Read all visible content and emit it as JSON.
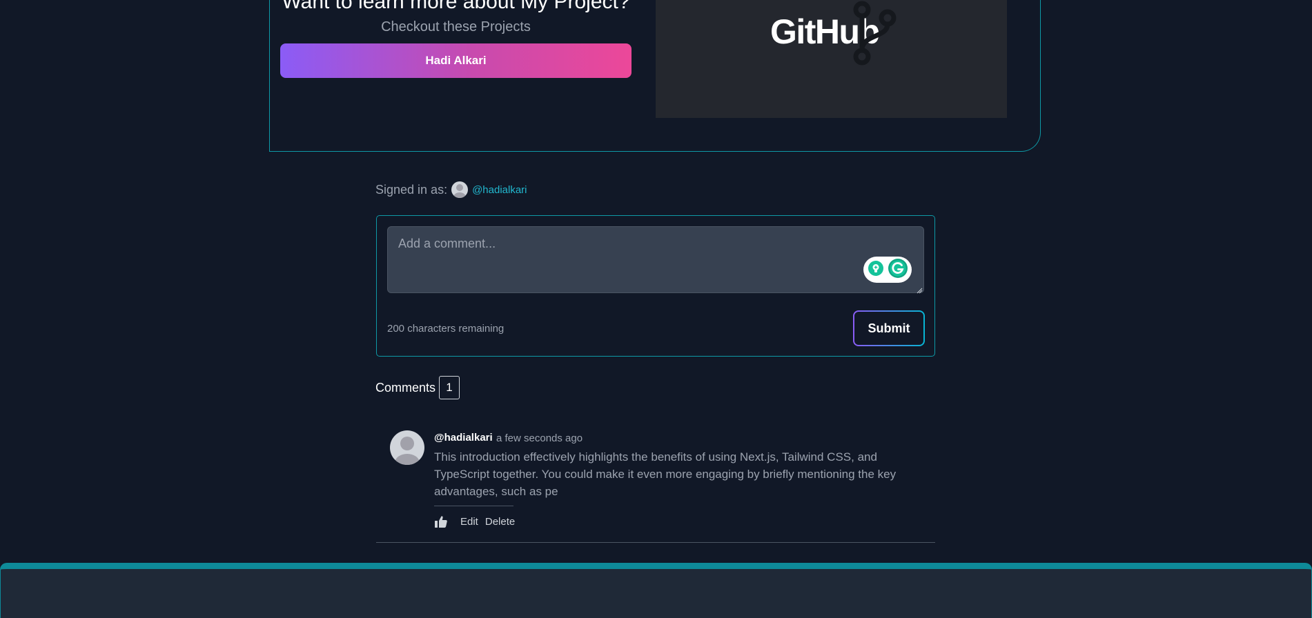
{
  "promo": {
    "heading": "Want to learn more about My Project?",
    "subheading": "Checkout these Projects",
    "project_button_label": "Hadi Alkari",
    "github_wordmark": "GitHub"
  },
  "comments_section": {
    "signed_in_label": "Signed in as:",
    "username": "@hadialkari",
    "textarea_placeholder": "Add a comment...",
    "chars_remaining": "200 characters remaining",
    "submit_label": "Submit",
    "comments_title": "Comments",
    "comments_count": "1",
    "comments": [
      {
        "author": "@hadialkari",
        "time": "a few seconds ago",
        "body": "This introduction effectively highlights the benefits of using Next.js, Tailwind CSS, and TypeScript together. You could make it even more engaging by briefly mentioning the key advantages, such as pe",
        "edit_label": "Edit",
        "delete_label": "Delete"
      }
    ]
  },
  "icons": {
    "branch": "git-branch-icon",
    "like": "thumbs-up-icon",
    "avatar": "user-avatar-icon",
    "grammarly": "grammarly-icon",
    "lightbulb": "lightbulb-icon"
  },
  "colors": {
    "background": "#111827",
    "accent_teal": "#0e9aa7",
    "link_cyan": "#22b8cf",
    "gradient_start": "#8b5cf6",
    "gradient_end": "#ec4899",
    "grammarly_green": "#15c39a"
  }
}
